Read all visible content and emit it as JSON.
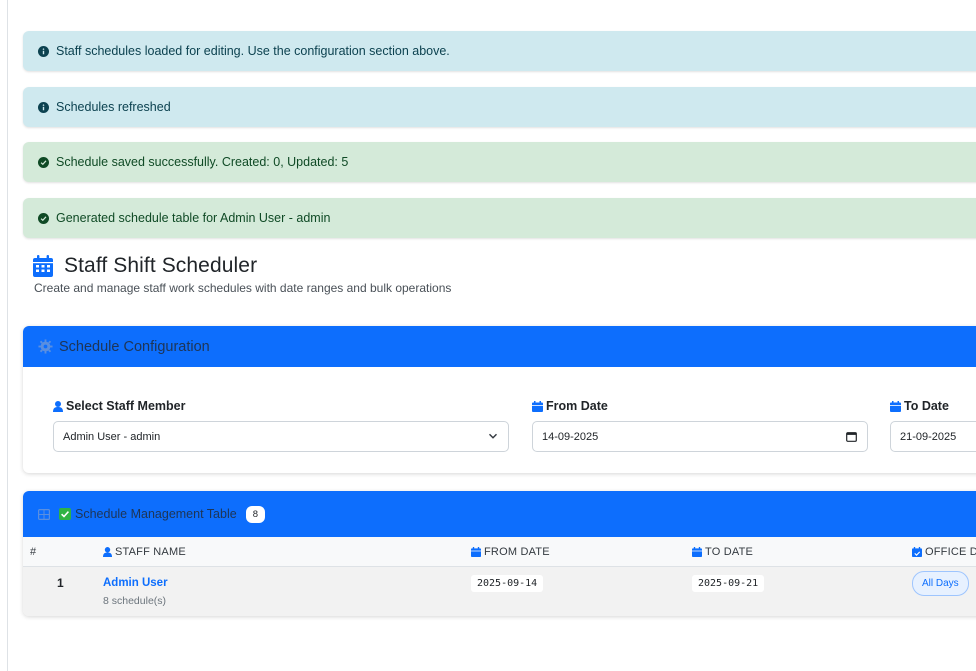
{
  "alerts": [
    {
      "type": "info",
      "text": "Staff schedules loaded for editing. Use the configuration section above."
    },
    {
      "type": "info",
      "text": "Schedules refreshed"
    },
    {
      "type": "success",
      "text": "Schedule saved successfully. Created: 0, Updated: 5"
    },
    {
      "type": "success",
      "text": "Generated schedule table for Admin User - admin"
    }
  ],
  "header": {
    "title": "Staff Shift Scheduler",
    "subtitle": "Create and manage staff work schedules with date ranges and bulk operations"
  },
  "config": {
    "title": "Schedule Configuration",
    "staff_label": "Select Staff Member",
    "staff_value": "Admin User - admin",
    "from_label": "From Date",
    "from_value": "14-09-2025",
    "to_label": "To Date",
    "to_value": "21-09-2025"
  },
  "table": {
    "title": "Schedule Management Table",
    "count": "8",
    "columns": {
      "num": "#",
      "staff": "STAFF NAME",
      "from": "FROM DATE",
      "to": "TO DATE",
      "office": "OFFICE DA"
    },
    "rows": [
      {
        "num": "1",
        "staff_name": "Admin User",
        "schedules": "8 schedule(s)",
        "from": "2025-09-14",
        "to": "2025-09-21",
        "office": "All Days"
      }
    ]
  },
  "colors": {
    "primary": "#0d6efd",
    "info_bg": "#cfe9ef",
    "success_bg": "#d4ead9"
  },
  "icons": {
    "info": "info-circle-icon",
    "success": "check-circle-icon",
    "title": "calendar-icon",
    "config": "gear-icon",
    "table": "table-grid-icon",
    "check": "checkbox-checked-icon",
    "user": "user-icon"
  }
}
